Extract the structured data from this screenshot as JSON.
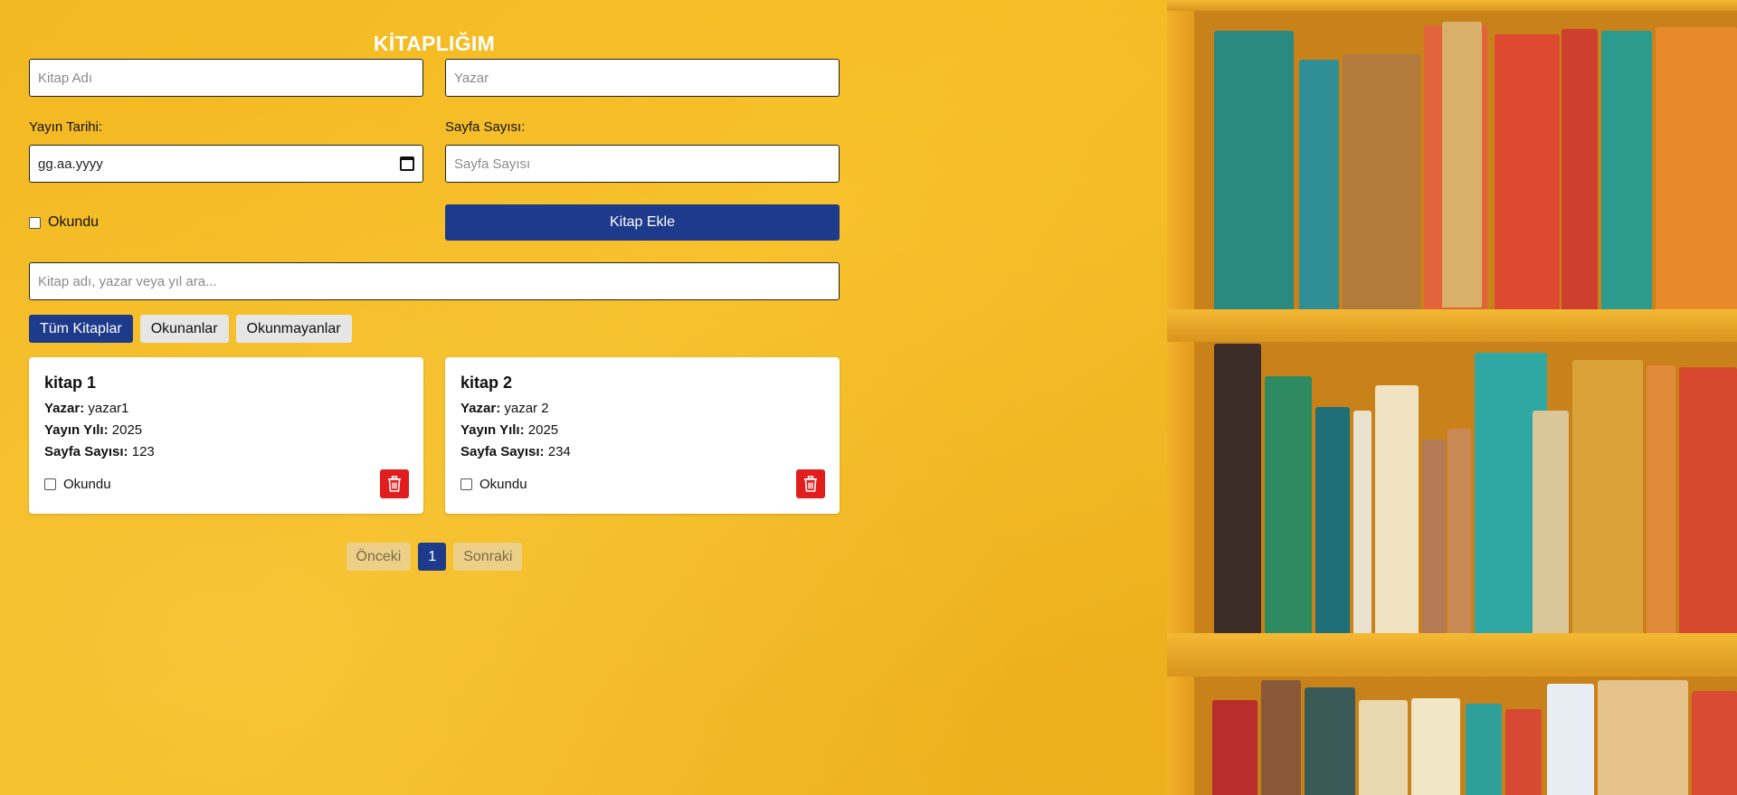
{
  "app": {
    "title": "KİTAPLIĞIM"
  },
  "form": {
    "book_name_placeholder": "Kitap Adı",
    "author_placeholder": "Yazar",
    "publish_date_label": "Yayın Tarihi:",
    "publish_date_value": "gg.aa.yyyy",
    "page_count_label": "Sayfa Sayısı:",
    "page_count_placeholder": "Sayfa Sayısı",
    "read_label": "Okundu",
    "add_button": "Kitap Ekle"
  },
  "search": {
    "placeholder": "Kitap adı, yazar veya yıl ara..."
  },
  "filters": [
    {
      "label": "Tüm Kitaplar",
      "active": true
    },
    {
      "label": "Okunanlar",
      "active": false
    },
    {
      "label": "Okunmayanlar",
      "active": false
    }
  ],
  "books": [
    {
      "title": "kitap 1",
      "author_label": "Yazar:",
      "author": "yazar1",
      "year_label": "Yayın Yılı:",
      "year": "2025",
      "pages_label": "Sayfa Sayısı:",
      "pages": "123",
      "read_label": "Okundu",
      "read": false
    },
    {
      "title": "kitap 2",
      "author_label": "Yazar:",
      "author": "yazar 2",
      "year_label": "Yayın Yılı:",
      "year": "2025",
      "pages_label": "Sayfa Sayısı:",
      "pages": "234",
      "read_label": "Okundu",
      "read": false
    }
  ],
  "pagination": {
    "prev": "Önceki",
    "current": "1",
    "next": "Sonraki"
  },
  "colors": {
    "primary": "#1e3a8a",
    "delete": "#e11d1d",
    "background": "#f5bd21"
  },
  "icons": {
    "delete": "trash-icon",
    "date": "calendar-icon"
  }
}
